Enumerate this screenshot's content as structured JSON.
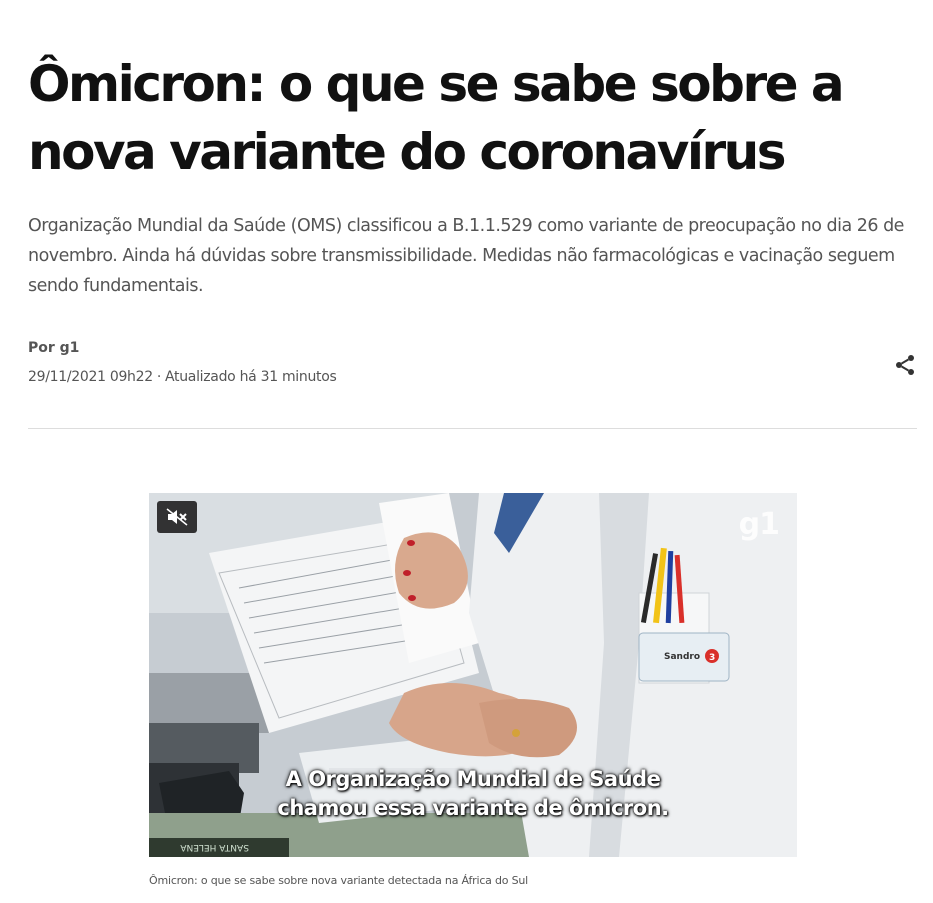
{
  "article": {
    "title": "Ômicron: o que se sabe sobre a nova variante do coronavírus",
    "subtitle": "Organização Mundial da Saúde (OMS) classificou a B.1.1.529 como variante de preocupação no dia 26 de novembro. Ainda há dúvidas sobre transmissibilidade. Medidas não farmacológicas e vacinação seguem sendo fundamentais.",
    "byline": "Por g1",
    "published": "29/11/2021 09h22",
    "separator": "·",
    "updated": "Atualizado há 31 minutos"
  },
  "share": {
    "icon": "share-icon"
  },
  "video": {
    "mute_icon": "muted-speaker-icon",
    "logo": "g1",
    "subtitle_line1": "A Organização Mundial de Saúde",
    "subtitle_line2": "chamou essa variante de ômicron.",
    "badge_name": "Sandro",
    "badge_number": "3",
    "caption": "Ômicron: o que se sabe sobre nova variante detectada na África do Sul"
  },
  "colors": {
    "headline": "#111111",
    "body_text": "#555555",
    "divider": "#dddddd",
    "badge_red": "#d9302a"
  }
}
